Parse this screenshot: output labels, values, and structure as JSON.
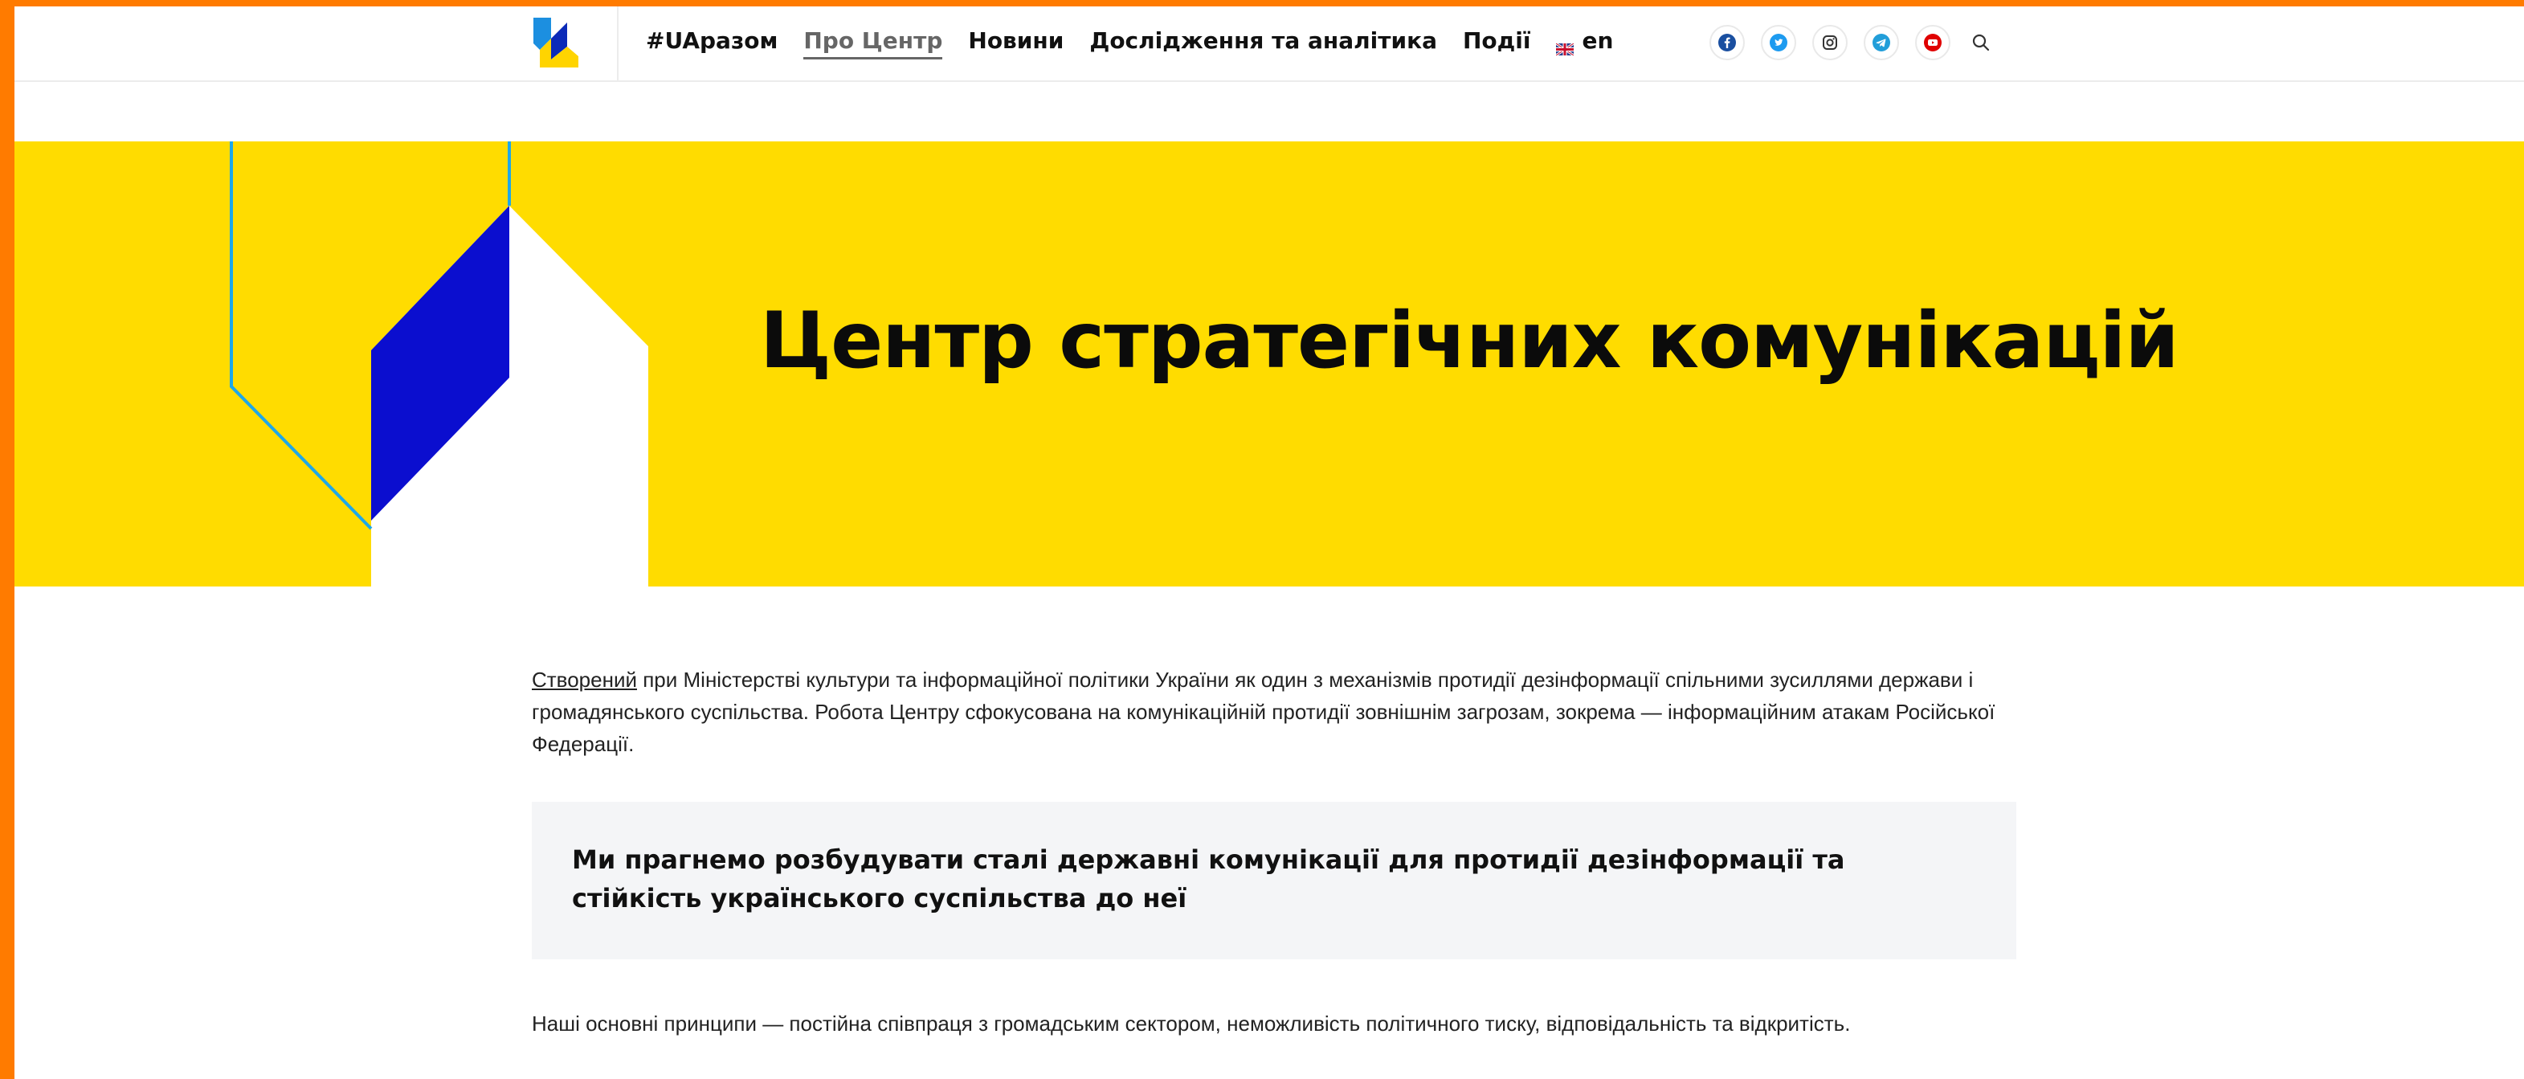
{
  "header": {
    "nav": [
      {
        "label": "#UAразом"
      },
      {
        "label": "Про Центр"
      },
      {
        "label": "Новини"
      },
      {
        "label": "Дослідження та аналітика"
      },
      {
        "label": "Події"
      }
    ],
    "active_nav": "Про Центр",
    "language": "en",
    "social_icons": [
      "facebook-icon",
      "twitter-icon",
      "instagram-icon",
      "telegram-icon",
      "youtube-icon"
    ],
    "search_icon": "search-icon"
  },
  "hero": {
    "title": "Центр стратегічних комунікацій"
  },
  "content": {
    "intro_link": "Створений",
    "intro_text": " при Міністерстві культури та інформаційної політики України як один з механізмів протидії дезінформації спільними зусиллями держави і громадянського суспільства. Робота Центру сфокусована на комунікаційній протидії зовнішнім загрозам, зокрема — інформаційним атакам Російської Федерації.",
    "quote": "Ми прагнемо розбудувати сталі державні комунікації для протидії дезінформації та стійкість українського суспільства до неї",
    "principles": "Наші основні принципи — постійна співпраця з громадським сектором, неможливість політичного тиску, відповідальність та відкритість."
  },
  "colors": {
    "frame": "#ff7b00",
    "hero_yellow": "#ffdc00",
    "hero_blue": "#0b0ecf",
    "hero_cyan_line": "#1ea7e8",
    "quote_bg": "#f4f5f7"
  }
}
